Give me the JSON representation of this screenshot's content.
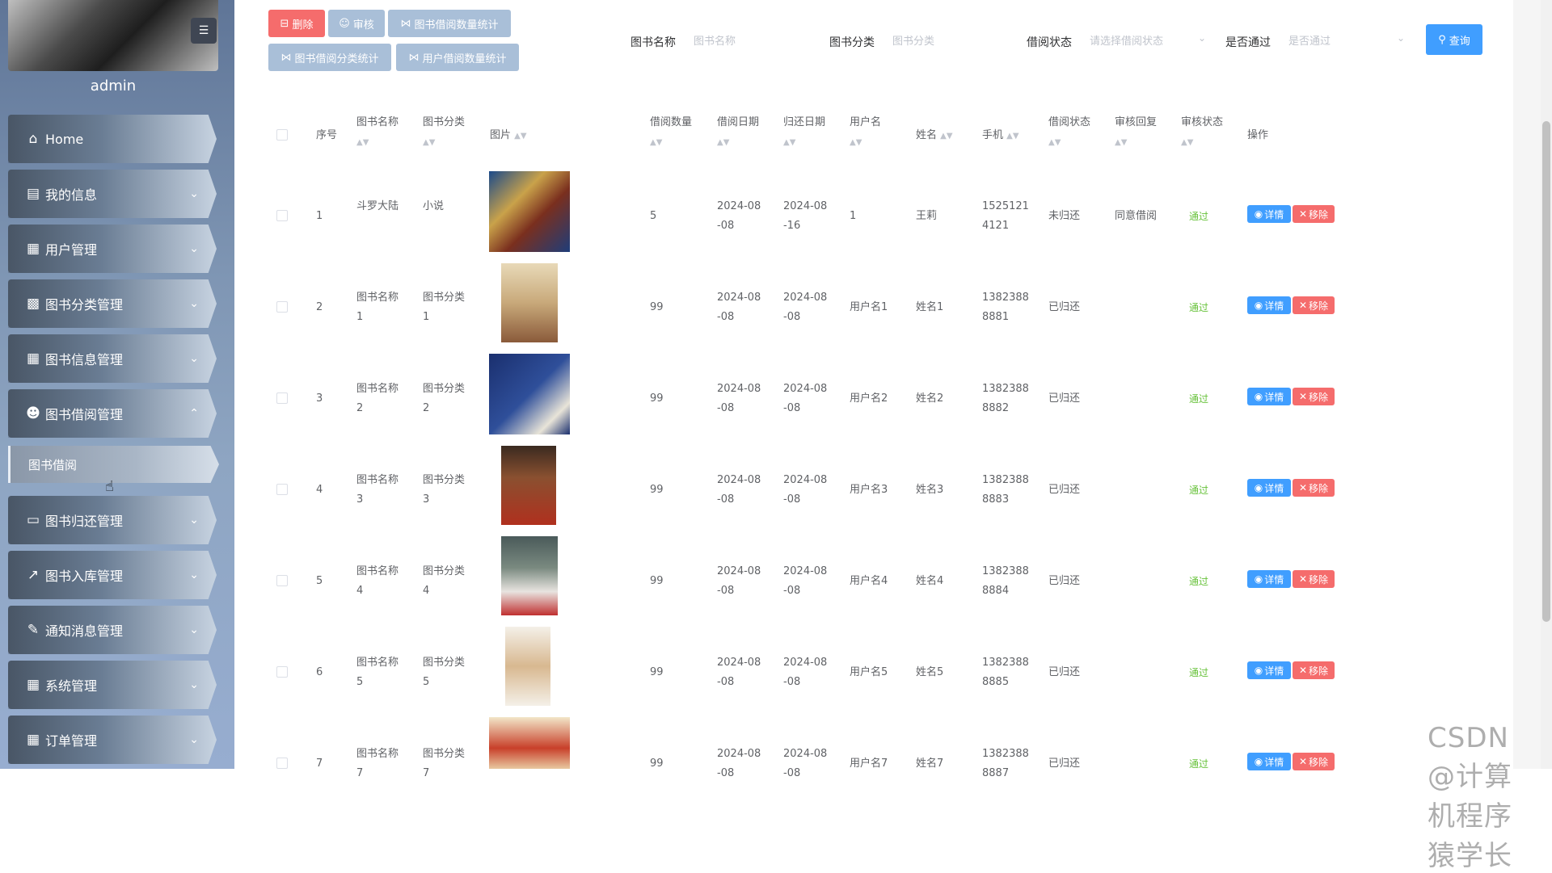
{
  "sidebar": {
    "username": "admin",
    "menu": [
      {
        "label": "Home",
        "icon": "home-icon",
        "has_chevron": false
      },
      {
        "label": "我的信息",
        "icon": "card-icon",
        "has_chevron": true
      },
      {
        "label": "用户管理",
        "icon": "grid-icon",
        "has_chevron": true
      },
      {
        "label": "图书分类管理",
        "icon": "briefcase-icon",
        "has_chevron": true
      },
      {
        "label": "图书信息管理",
        "icon": "grid-icon",
        "has_chevron": true
      },
      {
        "label": "图书借阅管理",
        "icon": "user-icon",
        "has_chevron": true,
        "expanded": true
      },
      {
        "label": "图书归还管理",
        "icon": "tray-icon",
        "has_chevron": true
      },
      {
        "label": "图书入库管理",
        "icon": "chart-icon",
        "has_chevron": true
      },
      {
        "label": "通知消息管理",
        "icon": "clipboard-icon",
        "has_chevron": true
      },
      {
        "label": "系统管理",
        "icon": "grid-icon",
        "has_chevron": true
      },
      {
        "label": "订单管理",
        "icon": "grid-icon",
        "has_chevron": true
      }
    ],
    "submenu_active": "图书借阅"
  },
  "toolbar": {
    "delete": "删除",
    "audit": "审核",
    "stat_count": "图书借阅数量统计",
    "stat_category": "图书借阅分类统计",
    "stat_user": "用户借阅数量统计"
  },
  "search": {
    "book_name_label": "图书名称",
    "book_name_placeholder": "图书名称",
    "category_label": "图书分类",
    "category_placeholder": "图书分类",
    "status_label": "借阅状态",
    "status_placeholder": "请选择借阅状态",
    "pass_label": "是否通过",
    "pass_placeholder": "是否通过",
    "query_button": "查询"
  },
  "table": {
    "headers": [
      "序号",
      "图书名称",
      "图书分类",
      "图片",
      "借阅数量",
      "借阅日期",
      "归还日期",
      "用户名",
      "姓名",
      "手机",
      "借阅状态",
      "审核回复",
      "审核状态",
      "操作"
    ],
    "detail_label": "详情",
    "remove_label": "移除",
    "rows": [
      {
        "index": "1",
        "name": [
          "斗罗大陆",
          ""
        ],
        "category": [
          "小说",
          ""
        ],
        "qty": "5",
        "borrow_date": [
          "2024-08",
          "-08"
        ],
        "return_date": [
          "2024-08",
          "-16"
        ],
        "username": "1",
        "realname": "王莉",
        "phone": [
          "1525121",
          "4121"
        ],
        "status": "未归还",
        "reply": "同意借阅",
        "audit": "通过"
      },
      {
        "index": "2",
        "name": [
          "图书名称",
          "1"
        ],
        "category": [
          "图书分类",
          "1"
        ],
        "qty": "99",
        "borrow_date": [
          "2024-08",
          "-08"
        ],
        "return_date": [
          "2024-08",
          "-08"
        ],
        "username": "用户名1",
        "realname": "姓名1",
        "phone": [
          "1382388",
          "8881"
        ],
        "status": "已归还",
        "reply": "",
        "audit": "通过"
      },
      {
        "index": "3",
        "name": [
          "图书名称",
          "2"
        ],
        "category": [
          "图书分类",
          "2"
        ],
        "qty": "99",
        "borrow_date": [
          "2024-08",
          "-08"
        ],
        "return_date": [
          "2024-08",
          "-08"
        ],
        "username": "用户名2",
        "realname": "姓名2",
        "phone": [
          "1382388",
          "8882"
        ],
        "status": "已归还",
        "reply": "",
        "audit": "通过"
      },
      {
        "index": "4",
        "name": [
          "图书名称",
          "3"
        ],
        "category": [
          "图书分类",
          "3"
        ],
        "qty": "99",
        "borrow_date": [
          "2024-08",
          "-08"
        ],
        "return_date": [
          "2024-08",
          "-08"
        ],
        "username": "用户名3",
        "realname": "姓名3",
        "phone": [
          "1382388",
          "8883"
        ],
        "status": "已归还",
        "reply": "",
        "audit": "通过"
      },
      {
        "index": "5",
        "name": [
          "图书名称",
          "4"
        ],
        "category": [
          "图书分类",
          "4"
        ],
        "qty": "99",
        "borrow_date": [
          "2024-08",
          "-08"
        ],
        "return_date": [
          "2024-08",
          "-08"
        ],
        "username": "用户名4",
        "realname": "姓名4",
        "phone": [
          "1382388",
          "8884"
        ],
        "status": "已归还",
        "reply": "",
        "audit": "通过"
      },
      {
        "index": "6",
        "name": [
          "图书名称",
          "5"
        ],
        "category": [
          "图书分类",
          "5"
        ],
        "qty": "99",
        "borrow_date": [
          "2024-08",
          "-08"
        ],
        "return_date": [
          "2024-08",
          "-08"
        ],
        "username": "用户名5",
        "realname": "姓名5",
        "phone": [
          "1382388",
          "8885"
        ],
        "status": "已归还",
        "reply": "",
        "audit": "通过"
      },
      {
        "index": "7",
        "name": [
          "图书名称",
          "7"
        ],
        "category": [
          "图书分类",
          "7"
        ],
        "qty": "99",
        "borrow_date": [
          "2024-08",
          "-08"
        ],
        "return_date": [
          "2024-08",
          "-08"
        ],
        "username": "用户名7",
        "realname": "姓名7",
        "phone": [
          "1382388",
          "8887"
        ],
        "status": "已归还",
        "reply": "",
        "audit": "通过"
      }
    ]
  },
  "watermark": "CSDN @计算机程序猿学长",
  "colors": {
    "danger": "#f56c6c",
    "primary": "#409eff",
    "success": "#67c23a",
    "muted_btn": "#a9bfd8"
  }
}
